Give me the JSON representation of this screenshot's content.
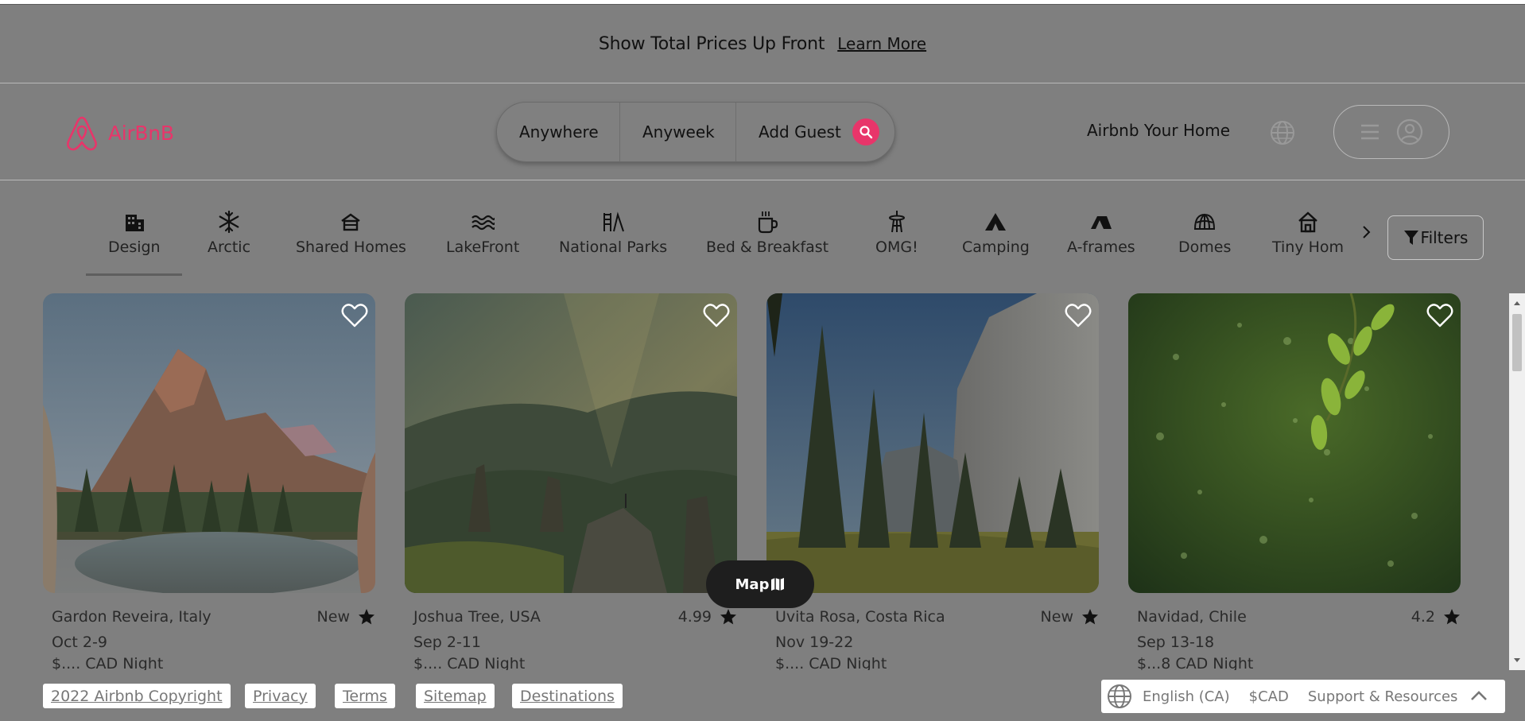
{
  "banner": {
    "text": "Show Total Prices Up Front",
    "link": "Learn More"
  },
  "header": {
    "logo_text": "AirBnB",
    "search": {
      "where": "Anywhere",
      "when": "Anyweek",
      "who": "Add Guest"
    },
    "host_link": "Airbnb Your Home"
  },
  "colors": {
    "brand": "#e8356a",
    "overlay": "#7f7f7f",
    "map_button": "#1e1e1e"
  },
  "categories": [
    {
      "label": "Design",
      "icon": "building-icon",
      "selected": true
    },
    {
      "label": "Arctic",
      "icon": "snowflake-icon"
    },
    {
      "label": "Shared Homes",
      "icon": "shared-home-icon"
    },
    {
      "label": "LakeFront",
      "icon": "waves-icon"
    },
    {
      "label": "National Parks",
      "icon": "park-icon"
    },
    {
      "label": "Bed & Breakfast",
      "icon": "coffee-icon"
    },
    {
      "label": "OMG!",
      "icon": "space-needle-icon"
    },
    {
      "label": "Camping",
      "icon": "tent-icon"
    },
    {
      "label": "A-frames",
      "icon": "a-frame-icon"
    },
    {
      "label": "Domes",
      "icon": "dome-icon"
    },
    {
      "label": "Tiny Hom",
      "icon": "tiny-home-icon"
    }
  ],
  "filters_label": "Filters",
  "listings": [
    {
      "location": "Gardon Reveira, Italy",
      "rating": "New",
      "dates": "Oct 2-9",
      "price": "$.... CAD Night"
    },
    {
      "location": "Joshua Tree, USA",
      "rating": "4.99",
      "dates": "Sep 2-11",
      "price": "$.... CAD Night"
    },
    {
      "location": "Uvita Rosa, Costa Rica",
      "rating": "New",
      "dates": "Nov 19-22",
      "price": "$.... CAD Night"
    },
    {
      "location": "Navidad, Chile",
      "rating": "4.2",
      "dates": "Sep 13-18",
      "price": "$...8 CAD Night"
    }
  ],
  "map_button": "Map",
  "footer": {
    "links": [
      "2022 Airbnb Copyright",
      "Privacy",
      "Terms",
      "Sitemap",
      "Destinations"
    ],
    "language": "English (CA)",
    "currency": "$CAD",
    "support": "Support & Resources"
  }
}
